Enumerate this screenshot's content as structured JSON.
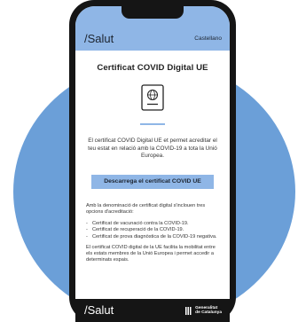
{
  "header": {
    "brand": "/Salut",
    "language": "Castellano"
  },
  "page": {
    "title": "Certificat COVID Digital UE",
    "passport_icon": "passport-icon",
    "intro": "El certificat COVID Digital UE et permet acreditar el teu estat en relació amb la COVID-19 a tota la Unió Europea.",
    "download_button": "Descarrega el certificat COVID UE",
    "details_intro": "Amb la denominació de certificat digital s'inclouen tres opcions d'acreditació:",
    "options": [
      "Certificat de vacunació contra la COVID-19.",
      "Certificat de recuperació de la COVID-19.",
      "Certificat de prova diagnòstica de la COVID-19 negativa."
    ],
    "details_outro": "El certificat COVID digital de la UE facilita la mobilitat entre els estats membres de la Unió Europea i permet accedir a determinats espais."
  },
  "footer": {
    "brand": "/Salut",
    "gov_line1": "Generalitat",
    "gov_line2": "de Catalunya"
  },
  "colors": {
    "accent": "#8fb6e6",
    "background_circle": "#6b9fd8",
    "phone": "#151515"
  }
}
